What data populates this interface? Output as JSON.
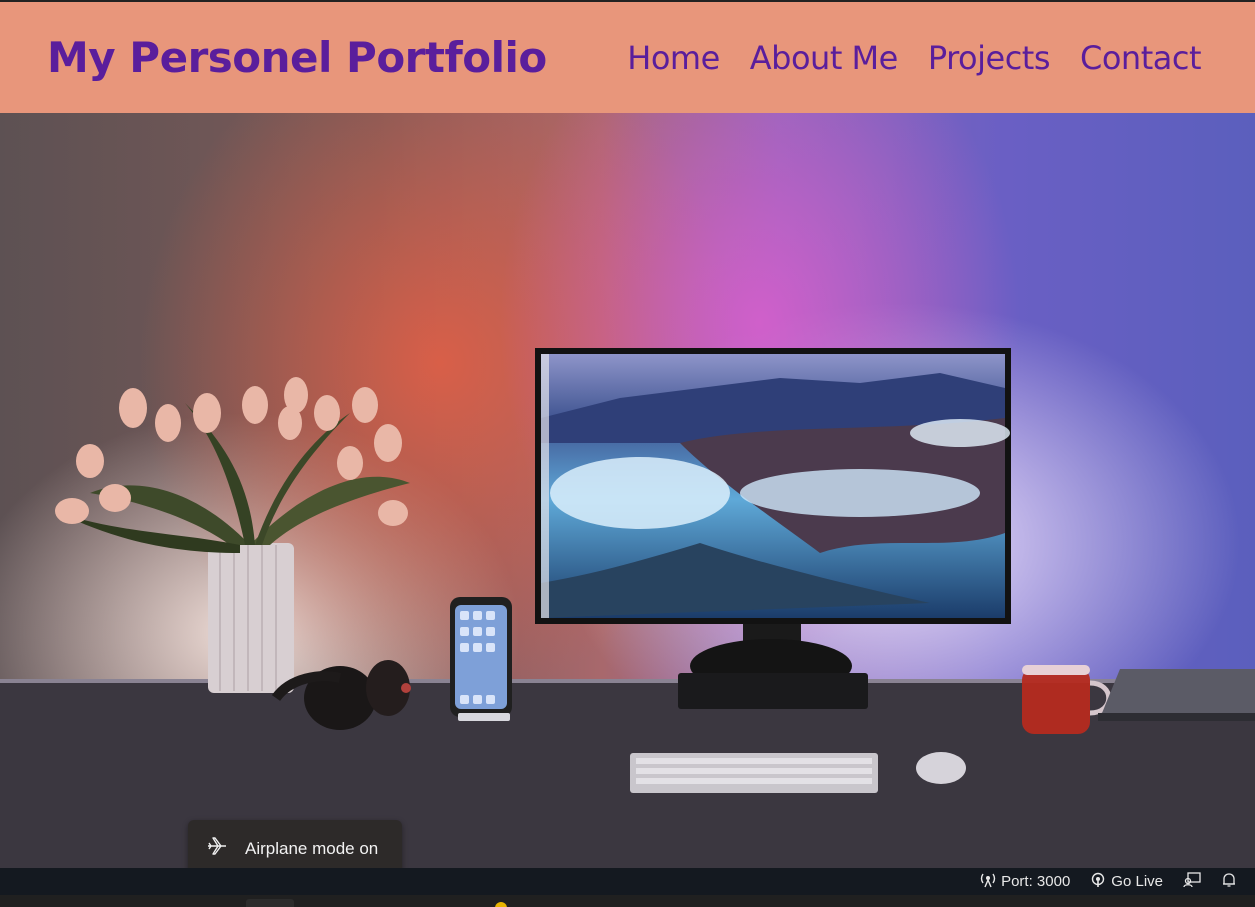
{
  "navbar": {
    "brand": "My Personel Portfolio",
    "links": [
      "Home",
      "About Me",
      "Projects",
      "Contact"
    ]
  },
  "toast": {
    "text": "Airplane mode on",
    "icon": "airplane-icon"
  },
  "statusbar": {
    "port": "Port: 3000",
    "go_live": "Go Live",
    "icons": [
      "broadcast-icon",
      "go-live-icon",
      "feedback-icon",
      "bell-icon"
    ]
  },
  "colors": {
    "navbar_bg": "#e8967b",
    "brand_text": "#5a1e9c",
    "statusbar_bg": "#141920"
  }
}
